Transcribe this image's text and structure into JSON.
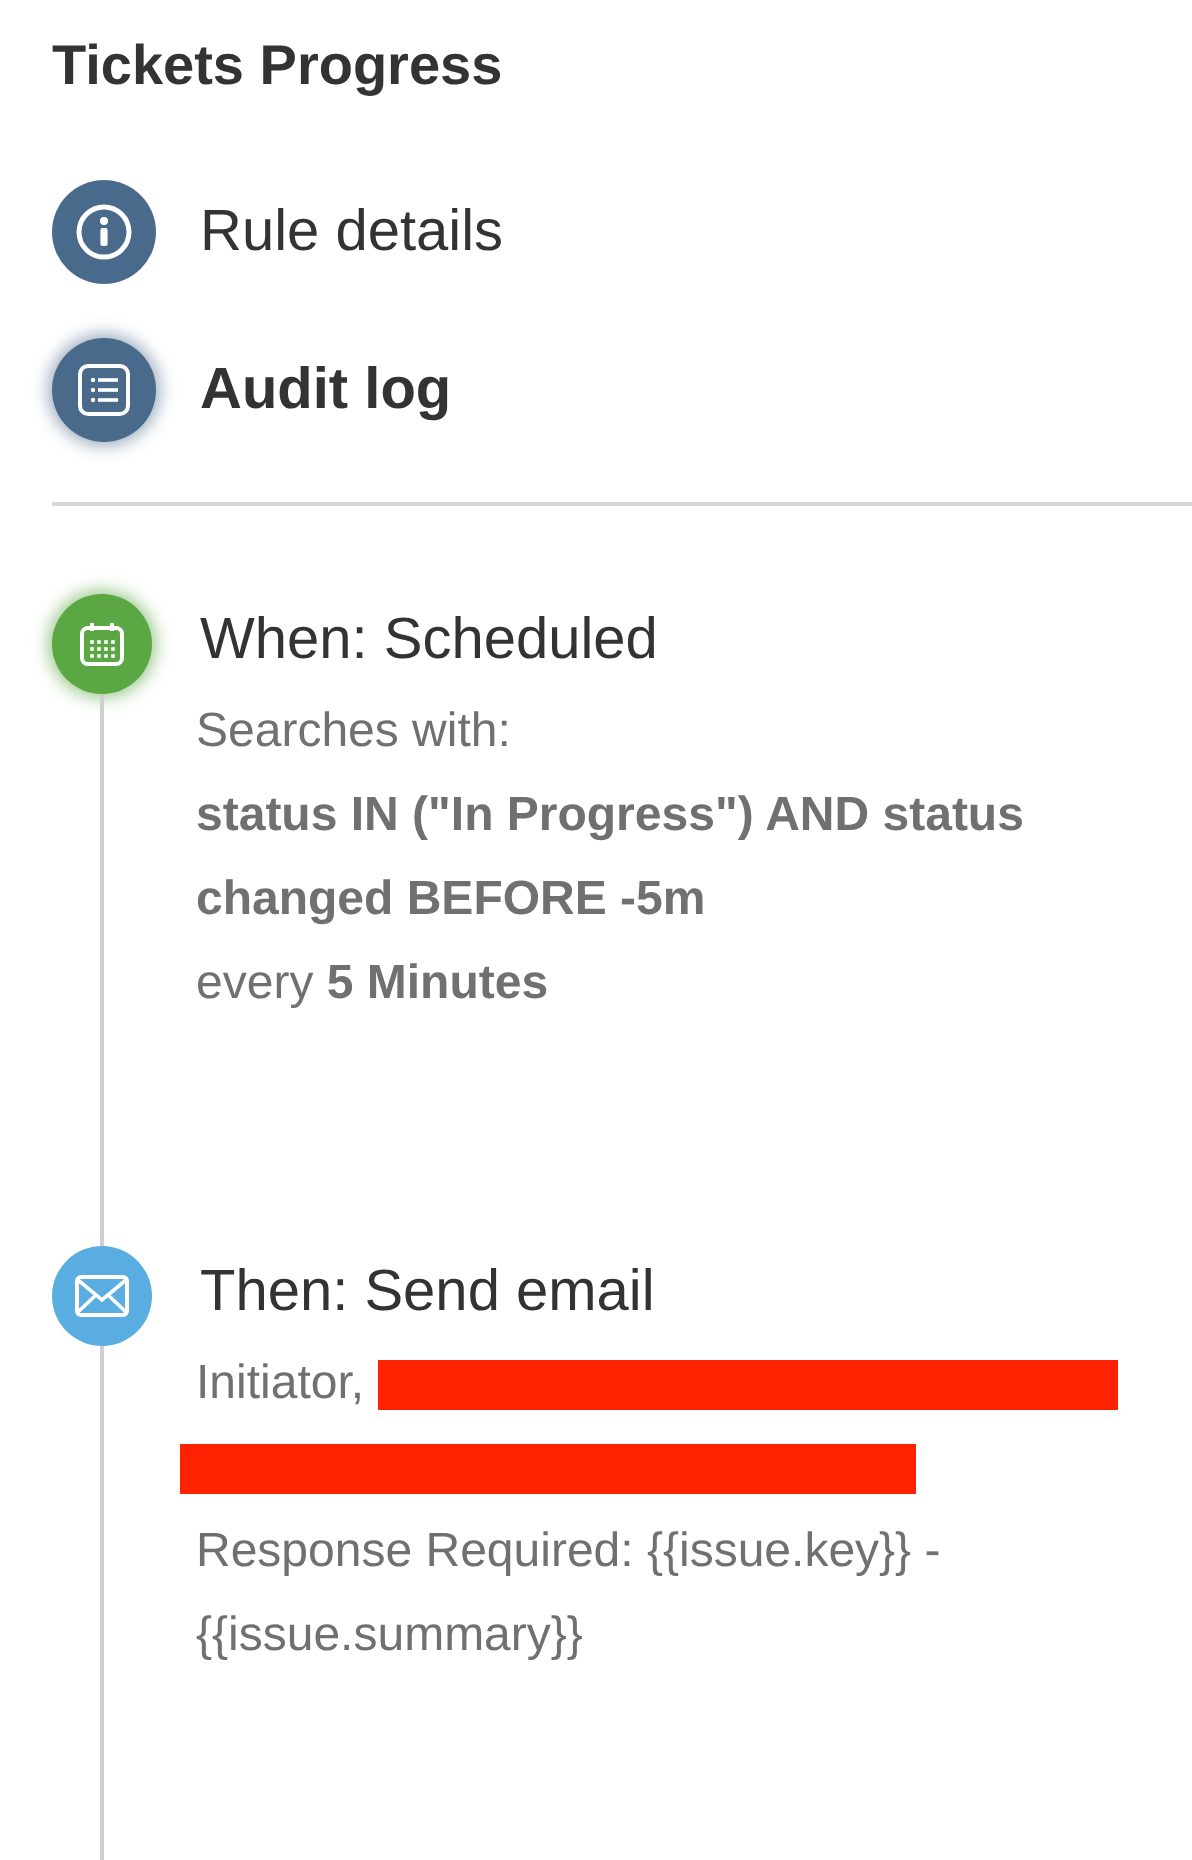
{
  "title": "Tickets Progress",
  "nav": [
    {
      "label": "Rule details",
      "kind": "info",
      "selected": false
    },
    {
      "label": "Audit log",
      "kind": "log",
      "selected": true
    }
  ],
  "steps": [
    {
      "kind": "trigger",
      "heading": "When: Scheduled",
      "lines": [
        "Searches with:",
        "**status IN (\"In Progress\") AND status changed BEFORE -5m**",
        "every **5 Minutes**"
      ]
    },
    {
      "kind": "action",
      "heading": "Then: Send email",
      "recipients": "Initiator,",
      "redacted": true,
      "lines": [
        "Response Required: {{issue.key}} - {{issue.summary}}"
      ]
    }
  ]
}
